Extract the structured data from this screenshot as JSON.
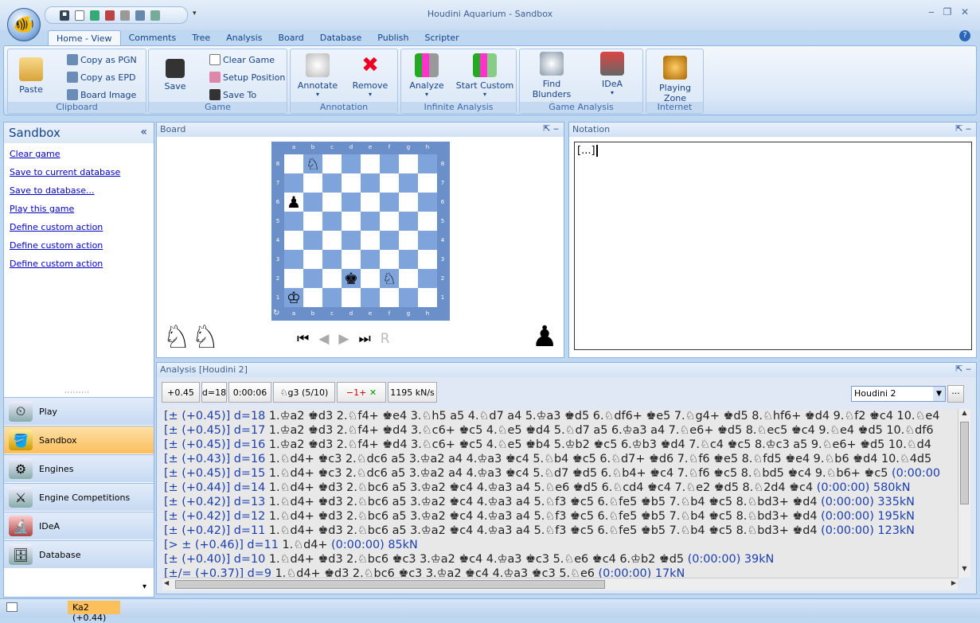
{
  "window": {
    "title": "Houdini Aquarium - Sandbox"
  },
  "tabs": [
    "Home - View",
    "Comments",
    "Tree",
    "Analysis",
    "Board",
    "Database",
    "Publish",
    "Scripter"
  ],
  "ribbon": {
    "clipboard": {
      "label": "Clipboard",
      "paste": "Paste",
      "copy_pgn": "Copy as PGN",
      "copy_epd": "Copy as EPD",
      "board_image": "Board Image"
    },
    "game": {
      "label": "Game",
      "save": "Save",
      "clear": "Clear Game",
      "setup": "Setup Position",
      "save_to": "Save To"
    },
    "annotation": {
      "label": "Annotation",
      "annotate": "Annotate",
      "remove": "Remove"
    },
    "infinite": {
      "label": "Infinite Analysis",
      "analyze": "Analyze",
      "start_custom": "Start Custom"
    },
    "game_analysis": {
      "label": "Game Analysis",
      "find_blunders": "Find Blunders",
      "idea": "IDeA"
    },
    "internet": {
      "label": "Internet",
      "playing_zone": "Playing Zone"
    }
  },
  "sandbox": {
    "title": "Sandbox",
    "links": [
      "Clear game",
      "Save to current database",
      "Save to database...",
      "Play this game",
      "Define custom action",
      "Define custom action",
      "Define custom action"
    ],
    "nav": [
      "Play",
      "Sandbox",
      "Engines",
      "Engine Competitions",
      "IDeA",
      "Database"
    ]
  },
  "board": {
    "title": "Board",
    "files": [
      "a",
      "b",
      "c",
      "d",
      "e",
      "f",
      "g",
      "h"
    ],
    "ranks": [
      "8",
      "7",
      "6",
      "5",
      "4",
      "3",
      "2",
      "1"
    ],
    "pieces": [
      {
        "file": 1,
        "rank": 8,
        "glyph": "♘"
      },
      {
        "file": 0,
        "rank": 6,
        "glyph": "♟"
      },
      {
        "file": 3,
        "rank": 2,
        "glyph": "♚"
      },
      {
        "file": 5,
        "rank": 2,
        "glyph": "♘"
      },
      {
        "file": 0,
        "rank": 1,
        "glyph": "♔"
      }
    ],
    "white_material": "♘♘",
    "black_material": "♟"
  },
  "notation": {
    "title": "Notation",
    "content": "[...]"
  },
  "analysis": {
    "title": "Analysis [Houdini 2]",
    "eval": "+0.45",
    "depth": "d=18",
    "time": "0:00:06",
    "current_move": "♘g3 (5/10)",
    "plies": "−1+",
    "speed": "1195 kN/s",
    "engine": "Houdini 2",
    "more": "...",
    "lines": [
      {
        "ev": "[± (+0.45)] d=18",
        "mv": " 1.♔a2 ♚d3 2.♘f4+ ♚e4 3.♘h5 a5 4.♘d7 a4 5.♔a3 ♚d5 6.♘df6+ ♚e5 7.♘g4+ ♚d5 8.♘hf6+ ♚d4 9.♘f2 ♚c4 10.♘e4",
        "tm": ""
      },
      {
        "ev": "[± (+0.45)] d=17",
        "mv": " 1.♔a2 ♚d3 2.♘f4+ ♚d4 3.♘c6+ ♚c5 4.♘e5 ♚d4 5.♘d7 a5 6.♔a3 a4 7.♘e6+ ♚d5 8.♘ec5 ♚c4 9.♘e4 ♚d5 10.♘df6",
        "tm": ""
      },
      {
        "ev": "[± (+0.45)] d=16",
        "mv": " 1.♔a2 ♚d3 2.♘f4+ ♚d4 3.♘c6+ ♚c5 4.♘e5 ♚b4 5.♔b2 ♚c5 6.♔b3 ♚d4 7.♘c4 ♚c5 8.♔c3 a5 9.♘e6+ ♚d5 10.♘d4",
        "tm": ""
      },
      {
        "ev": "[± (+0.43)] d=16",
        "mv": " 1.♘d4+ ♚c3 2.♘dc6 a5 3.♔a2 a4 4.♔a3 ♚c4 5.♘b4 ♚c5 6.♘d7+ ♚d6 7.♘f6 ♚e5 8.♘fd5 ♚e4 9.♘b6 ♚d4 10.♘4d5",
        "tm": ""
      },
      {
        "ev": "[± (+0.45)] d=15",
        "mv": " 1.♘d4+ ♚c3 2.♘dc6 a5 3.♔a2 a4 4.♔a3 ♚c4 5.♘d7 ♚d5 6.♘b4+ ♚c4 7.♘f6 ♚c5 8.♘bd5 ♚c4 9.♘b6+ ♚c5",
        "tm": " (0:00:00"
      },
      {
        "ev": "[± (+0.44)] d=14",
        "mv": " 1.♘d4+ ♚d3 2.♘bc6 a5 3.♔a2 ♚c4 4.♔a3 a4 5.♘e6 ♚d5 6.♘cd4 ♚c4 7.♘e2 ♚d5 8.♘2d4 ♚c4",
        "tm": " (0:00:00) 580kN"
      },
      {
        "ev": "[± (+0.42)] d=13",
        "mv": " 1.♘d4+ ♚d3 2.♘bc6 a5 3.♔a2 ♚c4 4.♔a3 a4 5.♘f3 ♚c5 6.♘fe5 ♚b5 7.♘b4 ♚c5 8.♘bd3+ ♚d4",
        "tm": " (0:00:00) 335kN"
      },
      {
        "ev": "[± (+0.42)] d=12",
        "mv": " 1.♘d4+ ♚d3 2.♘bc6 a5 3.♔a2 ♚c4 4.♔a3 a4 5.♘f3 ♚c5 6.♘fe5 ♚b5 7.♘b4 ♚c5 8.♘bd3+ ♚d4",
        "tm": " (0:00:00) 195kN"
      },
      {
        "ev": "[± (+0.42)] d=11",
        "mv": " 1.♘d4+ ♚d3 2.♘bc6 a5 3.♔a2 ♚c4 4.♔a3 a4 5.♘f3 ♚c5 6.♘fe5 ♚b5 7.♘b4 ♚c5 8.♘bd3+ ♚d4",
        "tm": " (0:00:00) 123kN"
      },
      {
        "ev": "[> ± (+0.46)] d=11",
        "mv": "  1.♘d4+",
        "tm": " (0:00:00) 85kN"
      },
      {
        "ev": "[± (+0.40)] d=10",
        "mv": " 1.♘d4+ ♚d3 2.♘bc6 ♚c3 3.♔a2 ♚c4 4.♔a3 ♚c3 5.♘e6 ♚c4 6.♔b2 ♚d5",
        "tm": " (0:00:00) 39kN"
      },
      {
        "ev": "[±/= (+0.37)] d=9",
        "mv": " 1.♘d4+ ♚d3 2.♘bc6 ♚c3 3.♔a2 ♚c4 4.♔a3 ♚c3 5.♘e6",
        "tm": " (0:00:00) 17kN"
      }
    ]
  },
  "status": {
    "move": "Ka2 (+0.44)"
  }
}
